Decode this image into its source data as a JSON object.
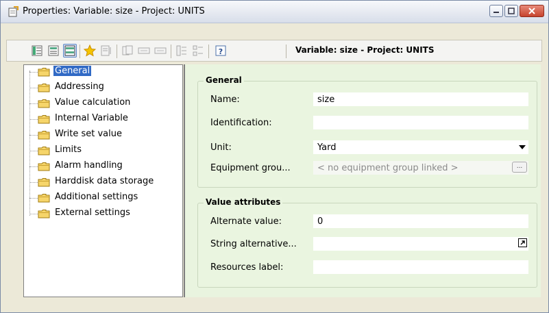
{
  "window": {
    "title": "Properties: Variable: size - Project: UNITS",
    "accent": "#316ac5",
    "panel_bg": "#e9f4df"
  },
  "toolbar": {
    "heading": "Variable: size - Project: UNITS",
    "icons": [
      "list-view-icon",
      "detail-view-icon",
      "grouped-view-icon",
      "favorite-star-icon",
      "properties-icon",
      "copy-icon",
      "field-icon",
      "field-alt-icon",
      "expand-all-icon",
      "collapse-all-icon",
      "help-icon"
    ]
  },
  "tree": {
    "items": [
      {
        "label": "General",
        "selected": true
      },
      {
        "label": "Addressing"
      },
      {
        "label": "Value calculation"
      },
      {
        "label": "Internal Variable"
      },
      {
        "label": "Write set value"
      },
      {
        "label": "Limits"
      },
      {
        "label": "Alarm handling"
      },
      {
        "label": "Harddisk data storage"
      },
      {
        "label": "Additional settings"
      },
      {
        "label": "External settings"
      }
    ]
  },
  "general": {
    "title": "General",
    "name_label": "Name:",
    "name_value": "size",
    "identification_label": "Identification:",
    "identification_value": "",
    "unit_label": "Unit:",
    "unit_value": "Yard",
    "equipment_label": "Equipment grou...",
    "equipment_value": "< no equipment group linked >",
    "equipment_button": "..."
  },
  "value_attributes": {
    "title": "Value attributes",
    "alternate_label": "Alternate value:",
    "alternate_value": "0",
    "string_alt_label": "String alternative...",
    "string_alt_value": "",
    "resources_label": "Resources label:",
    "resources_value": ""
  }
}
